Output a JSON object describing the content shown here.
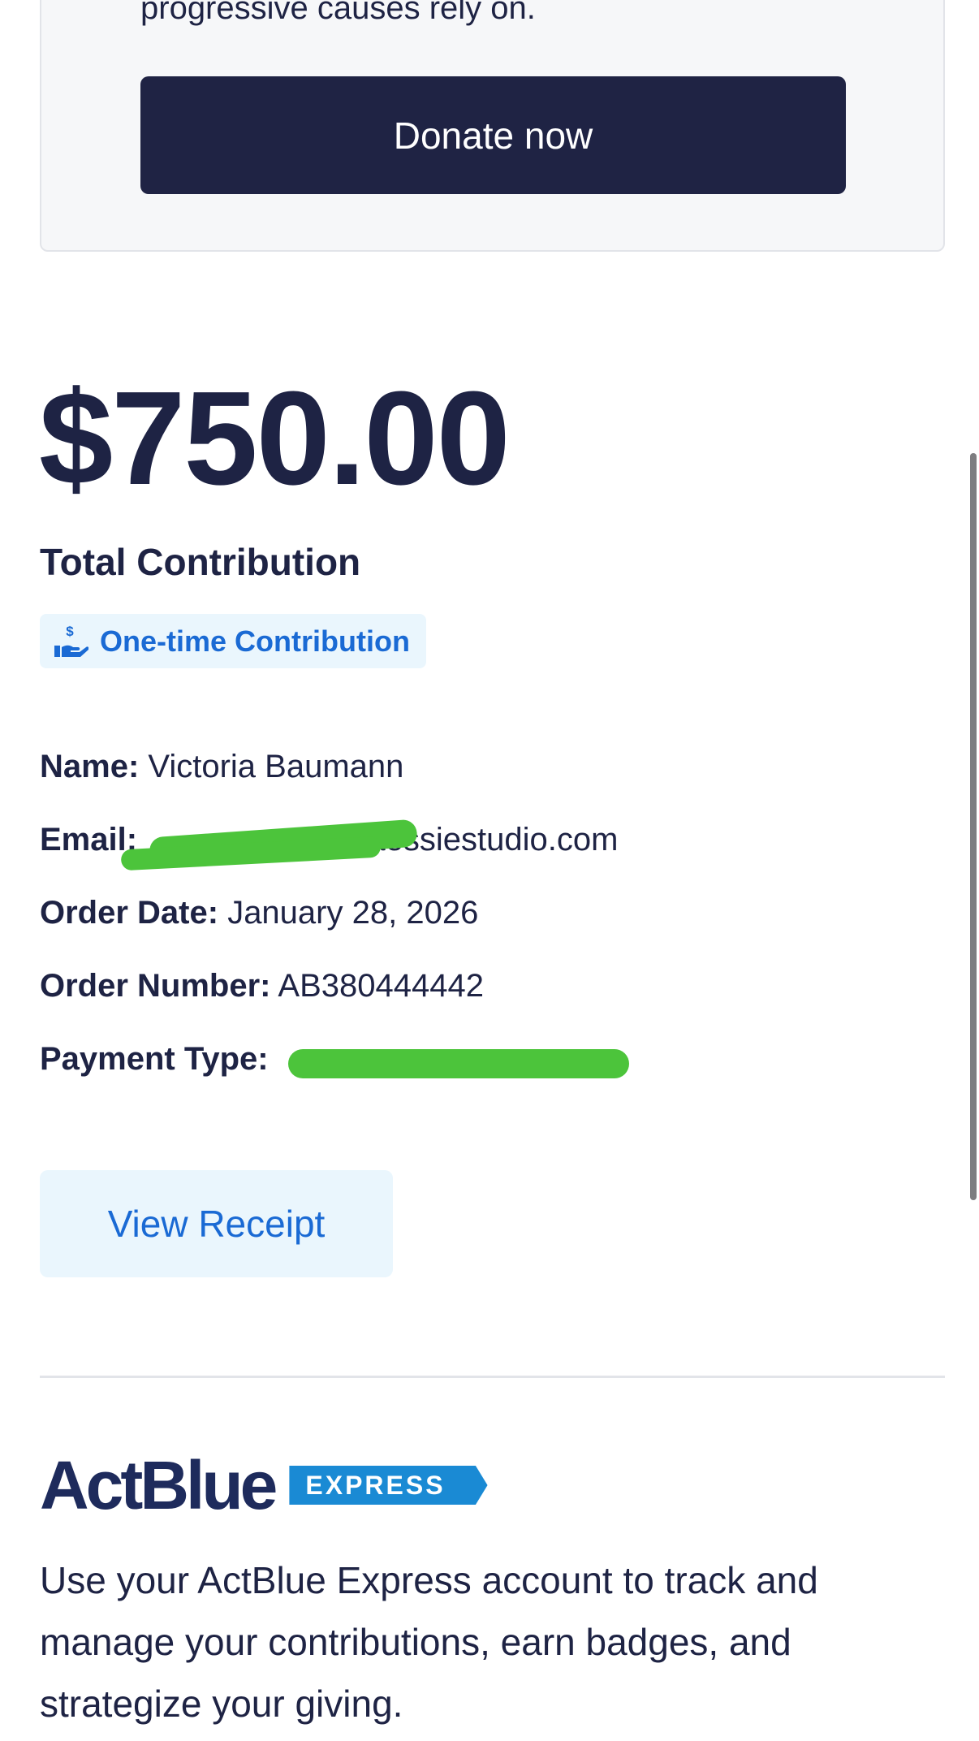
{
  "donate_card": {
    "text": "progressive causes rely on.",
    "button_label": "Donate now"
  },
  "summary": {
    "amount": "$750.00",
    "total_label": "Total Contribution",
    "badge_label": "One-time Contribution",
    "badge_icon": "hand-dollar-icon"
  },
  "details": {
    "name_label": "Name:",
    "name_value": "Victoria Baumann",
    "email_label": "Email:",
    "email_value": "naessiestudio.com",
    "order_date_label": "Order Date:",
    "order_date_value": "January 28, 2026",
    "order_number_label": "Order Number:",
    "order_number_value": "AB380444442",
    "payment_type_label": "Payment Type:",
    "payment_type_value": ""
  },
  "receipt": {
    "button_label": "View Receipt"
  },
  "express": {
    "logo_word": "ActBlue",
    "logo_tag": "EXPRESS",
    "description": "Use your ActBlue Express account to track and manage your contributions, earn badges, and strategize your giving."
  },
  "colors": {
    "navy": "#1f2344",
    "link_blue": "#1a6ad4",
    "light_blue_bg": "#eaf6fd",
    "express_blue": "#1a8ad4",
    "redaction_green": "#4cc43b"
  }
}
